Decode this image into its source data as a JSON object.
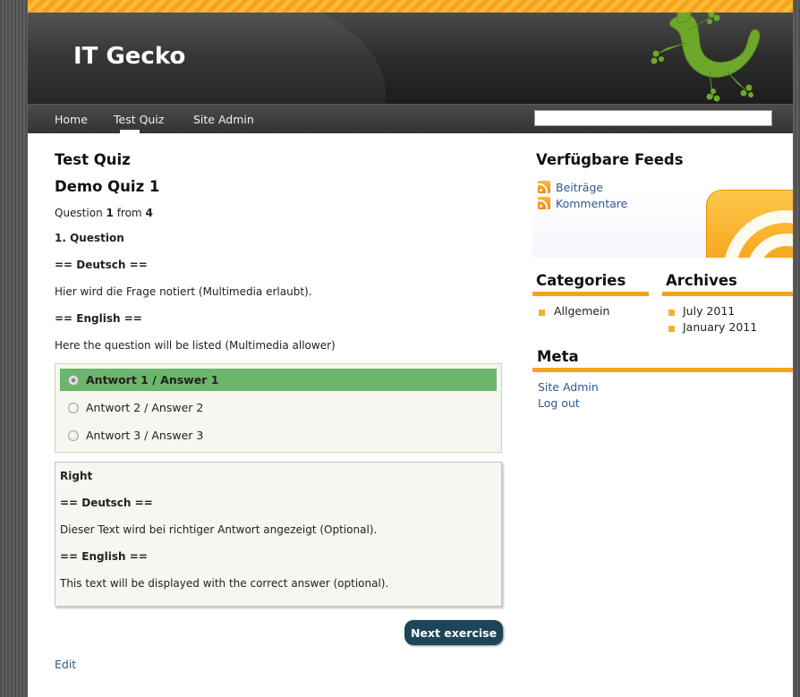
{
  "site": {
    "title": "IT Gecko"
  },
  "nav": {
    "items": [
      "Home",
      "Test Quiz",
      "Site Admin"
    ],
    "active": "Test Quiz"
  },
  "search": {
    "value": "",
    "placeholder": ""
  },
  "main": {
    "page_title": "Test Quiz",
    "quiz_title": "Demo Quiz 1",
    "progress": {
      "prefix": "Question",
      "current": "1",
      "middle": "from",
      "total": "4"
    },
    "question": {
      "title": "1. Question",
      "de_header": "== Deutsch ==",
      "de_text": "Hier wird die Frage notiert (Multimedia erlaubt).",
      "en_header": "== English ==",
      "en_text": "Here the question will be listed (Multimedia allower)"
    },
    "answers": [
      {
        "label": "Antwort 1 / Answer 1",
        "selected": true
      },
      {
        "label": "Antwort 2 / Answer 2",
        "selected": false
      },
      {
        "label": "Antwort 3 / Answer 3",
        "selected": false
      }
    ],
    "feedback": {
      "title": "Right",
      "de_header": "== Deutsch ==",
      "de_text": "Dieser Text wird bei richtiger Antwort angezeigt (Optional).",
      "en_header": "== English ==",
      "en_text": "This text will be displayed with the correct answer (optional)."
    },
    "next_button": "Next exercise",
    "edit_link": "Edit"
  },
  "sidebar": {
    "feeds": {
      "title": "Verfügbare Feeds",
      "items": [
        "Beiträge",
        "Kommentare"
      ]
    },
    "categories": {
      "title": "Categories",
      "items": [
        "Allgemein"
      ]
    },
    "archives": {
      "title": "Archives",
      "items": [
        "July 2011",
        "January 2011"
      ]
    },
    "meta": {
      "title": "Meta",
      "items": [
        "Site Admin",
        "Log out"
      ]
    }
  },
  "colors": {
    "accent_orange": "#f7a21b",
    "selected_answer": "#6cb56c",
    "button_bg": "#1c4557",
    "link": "#2d5a8c",
    "gecko_green": "#6ea82a"
  }
}
